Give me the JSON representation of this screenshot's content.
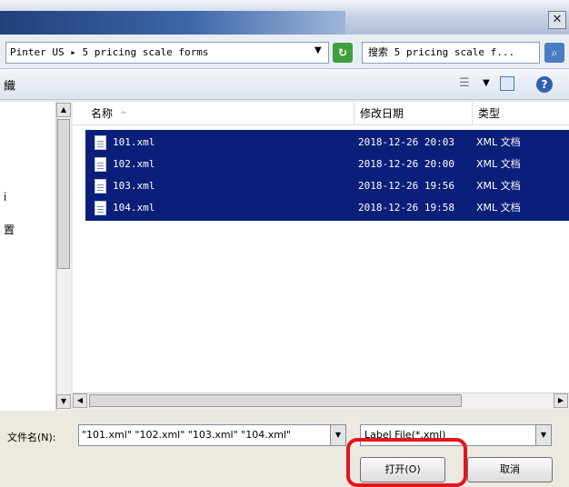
{
  "window": {
    "close_glyph": "✕"
  },
  "addressbar": {
    "path": "Pinter US ▸ 5 pricing scale forms",
    "search_text": "搜索 5 pricing scale f..."
  },
  "toolbar": {
    "fragment": "織"
  },
  "nav": {
    "fragments": [
      "",
      "",
      "i",
      "置"
    ]
  },
  "columns": {
    "name": "名称",
    "sort_indicator": "^",
    "date": "修改日期",
    "type": "类型"
  },
  "files": [
    {
      "name": "101.xml",
      "date": "2018-12-26 20:03",
      "type": "XML 文档"
    },
    {
      "name": "102.xml",
      "date": "2018-12-26 20:00",
      "type": "XML 文档"
    },
    {
      "name": "103.xml",
      "date": "2018-12-26 19:56",
      "type": "XML 文档"
    },
    {
      "name": "104.xml",
      "date": "2018-12-26 19:58",
      "type": "XML 文档"
    }
  ],
  "bottom": {
    "filename_label": "文件名(N):",
    "filename_value": "\"101.xml\" \"102.xml\" \"103.xml\" \"104.xml\"",
    "filetype_value": "Label File(*.xml)",
    "open_label": "打开(O)",
    "cancel_label": "取消"
  },
  "colors": {
    "selection": "#0b1f7a",
    "highlight": "#e2141c"
  }
}
